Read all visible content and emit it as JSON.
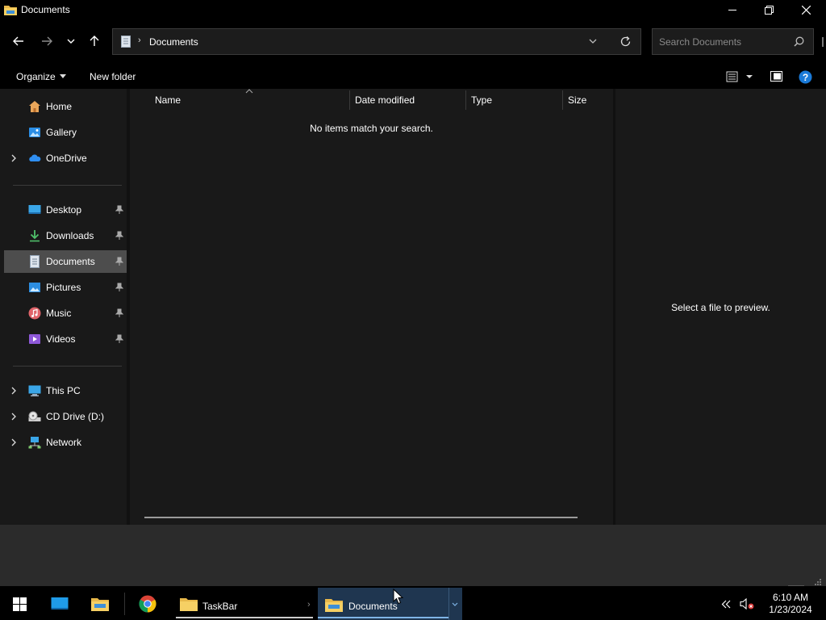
{
  "window": {
    "title": "Documents",
    "icons": {
      "app": "folder-icon",
      "minimize": "minimize-icon",
      "maximize": "restore-icon",
      "close": "close-icon"
    }
  },
  "nav": {
    "icons": {
      "back": "arrow-left-icon",
      "forward": "arrow-right-icon",
      "recent": "chevron-down-icon",
      "up": "arrow-up-icon"
    }
  },
  "address": {
    "crumbs": [
      "Documents"
    ],
    "icons": {
      "location": "documents-icon",
      "dropdown": "chevron-down-icon",
      "refresh": "refresh-icon"
    }
  },
  "search": {
    "placeholder": "Search Documents",
    "value": "",
    "icon": "search-icon"
  },
  "commandbar": {
    "organize_label": "Organize",
    "new_folder_label": "New folder",
    "icons": {
      "view": "details-view-icon",
      "preview_pane": "preview-pane-icon",
      "help": "help-icon"
    }
  },
  "sidebar": {
    "groups": [
      [
        {
          "label": "Home",
          "icon": "home-icon",
          "expandable": false
        },
        {
          "label": "Gallery",
          "icon": "gallery-icon",
          "expandable": false
        },
        {
          "label": "OneDrive",
          "icon": "onedrive-cloud-icon",
          "expandable": true
        }
      ],
      [
        {
          "label": "Desktop",
          "icon": "desktop-icon",
          "pinned": true
        },
        {
          "label": "Downloads",
          "icon": "download-icon",
          "pinned": true
        },
        {
          "label": "Documents",
          "icon": "documents-icon",
          "pinned": true,
          "selected": true
        },
        {
          "label": "Pictures",
          "icon": "pictures-icon",
          "pinned": true
        },
        {
          "label": "Music",
          "icon": "music-icon",
          "pinned": true
        },
        {
          "label": "Videos",
          "icon": "videos-icon",
          "pinned": true
        }
      ],
      [
        {
          "label": "This PC",
          "icon": "pc-icon",
          "expandable": true
        },
        {
          "label": "CD Drive (D:)",
          "icon": "cd-drive-icon",
          "expandable": true
        },
        {
          "label": "Network",
          "icon": "network-icon",
          "expandable": true
        }
      ]
    ]
  },
  "content": {
    "columns": [
      "Name",
      "Date modified",
      "Type",
      "Size"
    ],
    "sort_column": "Name",
    "sort_direction": "ascending",
    "empty_message": "No items match your search."
  },
  "preview": {
    "message": "Select a file to preview."
  },
  "taskbar": {
    "pinned_icons": [
      "windows-start-icon",
      "desktop-icon",
      "file-explorer-icon",
      "chrome-icon"
    ],
    "tasks": [
      {
        "label": "TaskBar",
        "icon": "folder-icon",
        "active": false
      },
      {
        "label": "Documents",
        "icon": "file-explorer-icon",
        "active": true
      }
    ],
    "tray": {
      "icons": [
        "chevron-left-icon",
        "speaker-muted-icon"
      ],
      "time": "6:10 AM",
      "date": "1/23/2024"
    }
  },
  "colors": {
    "accent": "#1a7ad8",
    "selected_bg": "#4d4d4d",
    "pane_bg": "#191919",
    "status_bg": "#2b2b2b"
  }
}
